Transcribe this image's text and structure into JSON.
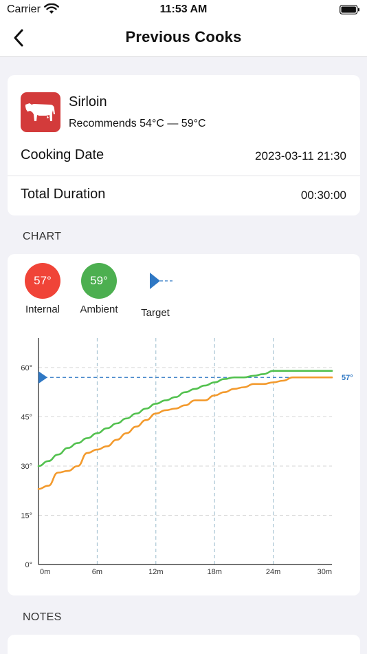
{
  "status": {
    "carrier": "Carrier",
    "time": "11:53 AM"
  },
  "nav": {
    "title": "Previous Cooks"
  },
  "cook": {
    "name": "Sirloin",
    "recommendation": "Recommends 54°C — 59°C",
    "cooking_date_label": "Cooking Date",
    "cooking_date_value": "2023-03-11  21:30",
    "duration_label": "Total Duration",
    "duration_value": "00:30:00"
  },
  "sections": {
    "chart": "CHART",
    "notes": "NOTES"
  },
  "legend": [
    {
      "value": "57°",
      "label": "Internal",
      "color": "#f04438"
    },
    {
      "value": "59°",
      "label": "Ambient",
      "color": "#4caf50"
    },
    {
      "value": "",
      "label": "Target",
      "color": "#2f78c4"
    }
  ],
  "colors": {
    "internal_line": "#f39a2d",
    "ambient_line": "#53c14f",
    "target_line": "#2f78c4",
    "cow_badge": "#d33b3b"
  },
  "chart_data": {
    "type": "line",
    "xlabel": "",
    "ylabel": "",
    "x_ticks": [
      "0m",
      "6m",
      "12m",
      "18m",
      "24m",
      "30m"
    ],
    "y_ticks": [
      "0°",
      "15°",
      "30°",
      "45°",
      "60°"
    ],
    "xlim": [
      0,
      30
    ],
    "ylim": [
      0,
      69
    ],
    "target": {
      "value": 57,
      "label": "57°"
    },
    "series": [
      {
        "name": "Ambient",
        "x": [
          0,
          1,
          2,
          3,
          4,
          5,
          6,
          7,
          8,
          9,
          10,
          11,
          12,
          13,
          14,
          15,
          16,
          17,
          18,
          19,
          20,
          21,
          22,
          23,
          24,
          25,
          26,
          27,
          28,
          29,
          30
        ],
        "values": [
          30,
          31.5,
          33.5,
          35.5,
          37,
          38.5,
          40,
          41.5,
          43,
          44.5,
          46,
          47.5,
          49,
          50,
          51,
          52.5,
          53.5,
          54.5,
          55.5,
          56.5,
          57,
          57,
          57.5,
          58,
          59,
          59,
          59,
          59,
          59,
          59,
          59
        ]
      },
      {
        "name": "Internal",
        "x": [
          0,
          1,
          2,
          3,
          4,
          5,
          6,
          7,
          8,
          9,
          10,
          11,
          12,
          13,
          14,
          15,
          16,
          17,
          18,
          19,
          20,
          21,
          22,
          23,
          24,
          25,
          26,
          27,
          28,
          29,
          30
        ],
        "values": [
          23,
          24,
          28,
          28.5,
          30,
          34,
          35,
          36,
          38,
          40,
          42,
          44,
          46,
          47,
          47.5,
          48.5,
          50,
          50,
          51.5,
          52.5,
          53.5,
          54,
          55,
          55,
          55.5,
          56,
          57,
          57,
          57,
          57,
          57
        ]
      }
    ]
  }
}
